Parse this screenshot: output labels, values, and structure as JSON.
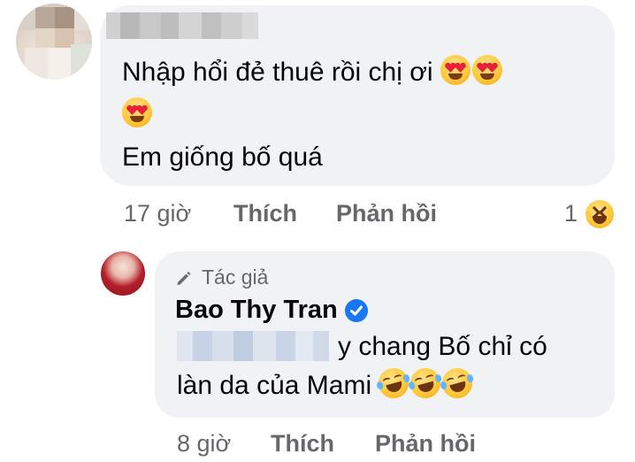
{
  "comment1": {
    "lines": [
      "Nhập hổi đẻ thuê rồi chị ơi",
      "Em giống bố quá"
    ],
    "emojis_line1": [
      "heart-eyes",
      "heart-eyes"
    ],
    "emojis_line2": [
      "heart-eyes"
    ],
    "time": "17 giờ",
    "like_label": "Thích",
    "reply_label": "Phản hồi",
    "reaction_count": "1",
    "reaction_emoji": "laughing"
  },
  "reply": {
    "author_badge": "Tác giả",
    "author_name": "Bao Thy Tran",
    "verified": true,
    "text_after_mention": "y chang Bố chỉ có",
    "text_line2": "làn da của Mami",
    "emojis": [
      "rolling-on-floor-laughing",
      "rolling-on-floor-laughing",
      "rolling-on-floor-laughing"
    ],
    "time": "8 giờ",
    "like_label": "Thích",
    "reply_label": "Phản hồi"
  },
  "colors": {
    "bubble_bg": "#f0f2f5",
    "meta_text": "#65676b",
    "verified_blue": "#1877f2",
    "text": "#050505"
  }
}
